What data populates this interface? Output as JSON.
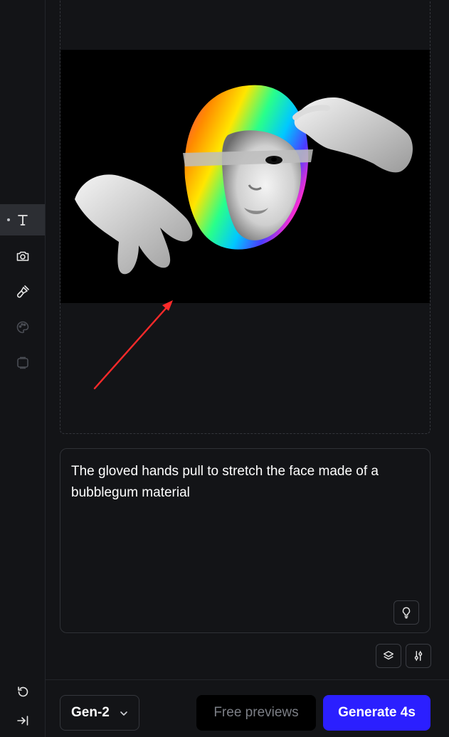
{
  "sidebar": {
    "tools": [
      {
        "name": "text-tool",
        "icon": "text-icon",
        "active": true
      },
      {
        "name": "camera-tool",
        "icon": "camera-icon",
        "active": false
      },
      {
        "name": "brush-tool",
        "icon": "brush-icon",
        "active": false
      },
      {
        "name": "palette-tool",
        "icon": "palette-icon",
        "active": false,
        "disabled": true
      },
      {
        "name": "frames-tool",
        "icon": "frames-icon",
        "active": false,
        "disabled": true
      }
    ],
    "bottom_icons": [
      "undo-icon",
      "collapse-icon"
    ]
  },
  "prompt": {
    "text": "The gloved hands pull to stretch the face made of a bubblegum material",
    "suggest_icon": "lightbulb-icon"
  },
  "toolbar": {
    "icons": [
      "layers-icon",
      "settings-sliders-icon"
    ]
  },
  "footer": {
    "model_label": "Gen-2",
    "free_previews_label": "Free previews",
    "generate_label": "Generate 4s"
  },
  "colors": {
    "background": "#131417",
    "accent": "#2b1fff",
    "annotation_arrow": "#ff2a2a"
  }
}
